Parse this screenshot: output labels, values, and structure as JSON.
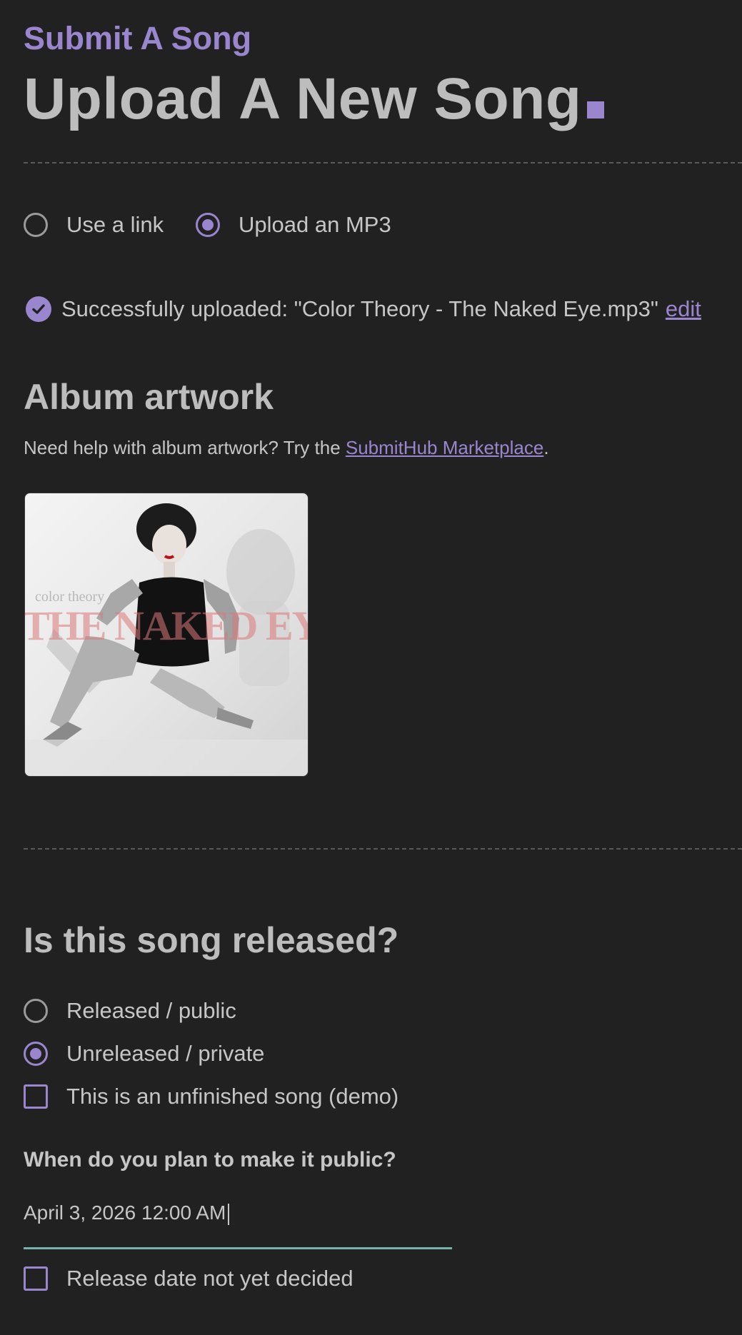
{
  "header": {
    "eyebrow": "Submit A Song",
    "title": "Upload A New Song"
  },
  "source": {
    "options": [
      {
        "label": "Use a link",
        "selected": false
      },
      {
        "label": "Upload an MP3",
        "selected": true
      }
    ]
  },
  "upload": {
    "status_text": "Successfully uploaded: \"Color Theory - The Naked Eye.mp3\"",
    "edit_label": "edit"
  },
  "artwork": {
    "heading": "Album artwork",
    "help_prefix": "Need help with album artwork? Try the ",
    "help_link": "SubmitHub Marketplace",
    "help_suffix": ".",
    "image_brand": "color theory",
    "image_title": "THE NAKED EYE"
  },
  "release": {
    "heading": "Is this song released?",
    "options": [
      {
        "label": "Released / public",
        "selected": false
      },
      {
        "label": "Unreleased / private",
        "selected": true
      }
    ],
    "demo_checkbox": {
      "label": "This is an unfinished song (demo)",
      "checked": false
    },
    "date_question": "When do you plan to make it public?",
    "date_value": "April 3, 2026 12:00 AM",
    "undecided_checkbox": {
      "label": "Release date not yet decided",
      "checked": false
    }
  },
  "colors": {
    "accent": "#9a86cf",
    "background": "#212121",
    "input_underline": "#73b5ad"
  }
}
